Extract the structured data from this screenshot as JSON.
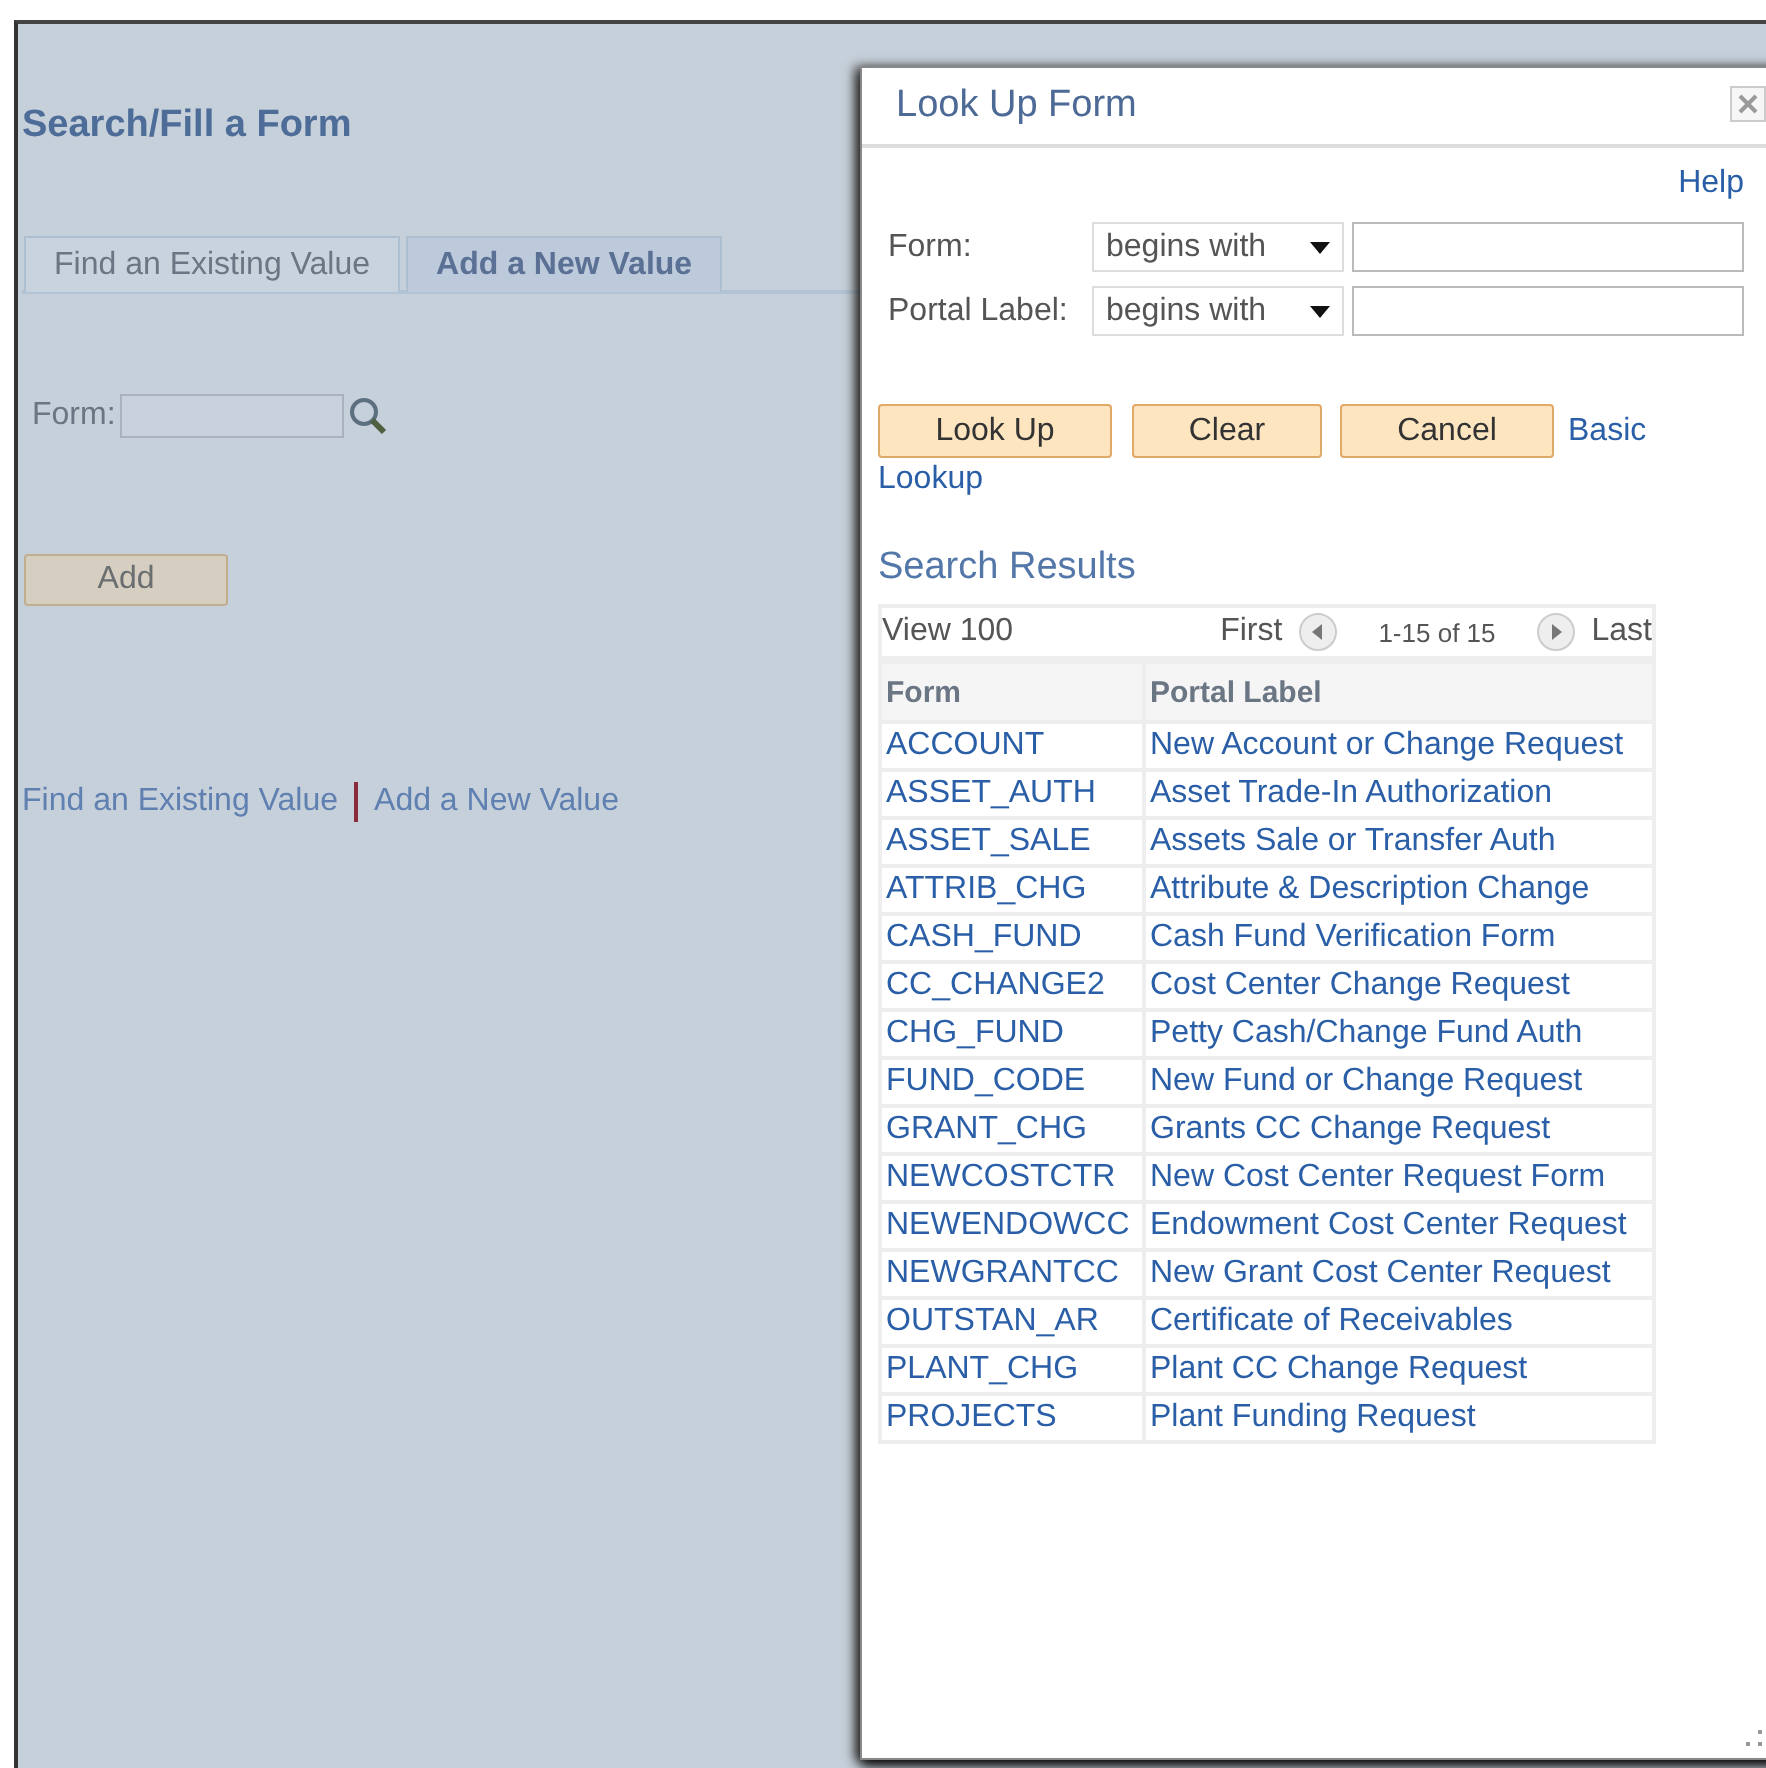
{
  "page": {
    "title": "Search/Fill a Form",
    "tabs": [
      {
        "label": "Find an Existing Value",
        "selected": false
      },
      {
        "label": "Add a New Value",
        "selected": true
      }
    ],
    "form_label": "Form:",
    "add_button": "Add",
    "footer_links": [
      "Find an Existing Value",
      "Add a New Value"
    ]
  },
  "dialog": {
    "title": "Look Up Form",
    "help": "Help",
    "criteria": [
      {
        "label": "Form:",
        "operator": "begins with"
      },
      {
        "label": "Portal Label:",
        "operator": "begins with"
      }
    ],
    "buttons": [
      "Look Up",
      "Clear",
      "Cancel"
    ],
    "basic_lookup": [
      "Basic",
      "Lookup"
    ],
    "results_title": "Search Results",
    "grid": {
      "view": "View 100",
      "first": "First",
      "range": "1-15 of 15",
      "last": "Last",
      "columns": [
        "Form",
        "Portal Label"
      ],
      "rows": [
        [
          "ACCOUNT",
          "New Account or Change Request"
        ],
        [
          "ASSET_AUTH",
          "Asset Trade-In Authorization"
        ],
        [
          "ASSET_SALE",
          "Assets Sale or Transfer Auth"
        ],
        [
          "ATTRIB_CHG",
          "Attribute & Description Change"
        ],
        [
          "CASH_FUND",
          "Cash Fund Verification Form"
        ],
        [
          "CC_CHANGE2",
          "Cost Center Change Request"
        ],
        [
          "CHG_FUND",
          "Petty Cash/Change Fund Auth"
        ],
        [
          "FUND_CODE",
          "New Fund or Change Request"
        ],
        [
          "GRANT_CHG",
          "Grants CC Change Request"
        ],
        [
          "NEWCOSTCTR",
          "New Cost Center Request Form"
        ],
        [
          "NEWENDOWCC",
          "Endowment Cost Center Request"
        ],
        [
          "NEWGRANTCC",
          "New Grant Cost Center Request"
        ],
        [
          "OUTSTAN_AR",
          "Certificate of Receivables"
        ],
        [
          "PLANT_CHG",
          "Plant CC Change Request"
        ],
        [
          "PROJECTS",
          "Plant Funding Request"
        ]
      ]
    }
  }
}
